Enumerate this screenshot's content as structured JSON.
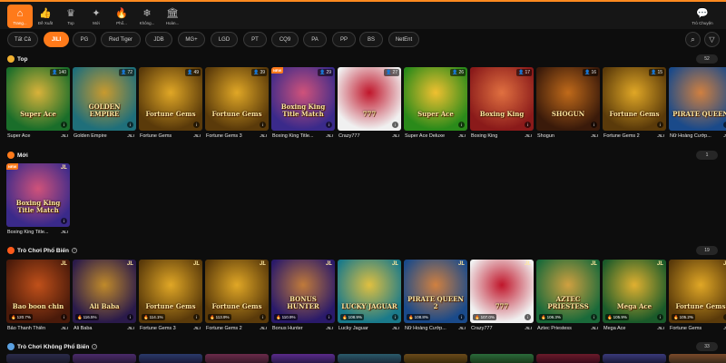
{
  "colors": {
    "accent": "#ff7a1a",
    "background": "#0d0d0d",
    "panel": "#161616"
  },
  "nav": {
    "items": [
      {
        "label": "Trang...",
        "icon": "home-icon",
        "glyph": "⌂",
        "active": true
      },
      {
        "label": "Đề Xuất",
        "icon": "thumbs-up-icon",
        "glyph": "👍",
        "active": false
      },
      {
        "label": "Top",
        "icon": "crown-icon",
        "glyph": "♛",
        "active": false
      },
      {
        "label": "Mới",
        "icon": "new-icon",
        "glyph": "✦",
        "active": false
      },
      {
        "label": "Phổ...",
        "icon": "fire-icon",
        "glyph": "🔥",
        "active": false
      },
      {
        "label": "Không...",
        "icon": "snowflake-icon",
        "glyph": "❄",
        "active": false
      },
      {
        "label": "Hoàn...",
        "icon": "gift-icon",
        "glyph": "🏛",
        "active": false
      }
    ],
    "right": {
      "label": "Trò Chuyện",
      "icon": "chat-icon",
      "glyph": "💬"
    }
  },
  "providers": [
    "Tất Cả",
    "JILI",
    "PG",
    "Red Tiger",
    "JDB",
    "MG+",
    "LGD",
    "PT",
    "CQ9",
    "PA",
    "PP",
    "BS",
    "NetEnt"
  ],
  "active_provider": "JILI",
  "sections": {
    "top": {
      "title": "Top",
      "count": "52",
      "games": [
        {
          "name": "Super Ace",
          "provider": "JILI",
          "players": "140",
          "logo": "Super Ace",
          "bg": "#1a6e2a",
          "bg2": "#d9b23a"
        },
        {
          "name": "Golden Empire",
          "provider": "JILI",
          "players": "72",
          "logo": "GOLDEN EMPIRE",
          "bg": "#1f6f7a",
          "bg2": "#c99a2e"
        },
        {
          "name": "Fortune Gems",
          "provider": "JILI",
          "players": "49",
          "logo": "Fortune Gems",
          "bg": "#5a3a0a",
          "bg2": "#e0a726"
        },
        {
          "name": "Fortune Gems 3",
          "provider": "JILI",
          "players": "39",
          "logo": "Fortune Gems",
          "bg": "#5a3a0a",
          "bg2": "#e0a726"
        },
        {
          "name": "Boxing King Title...",
          "provider": "JILI",
          "players": "29",
          "logo": "Boxing King Title Match",
          "bg": "#3a2a8a",
          "bg2": "#d0527a",
          "new": true
        },
        {
          "name": "Crazy777",
          "provider": "JILI",
          "players": "27",
          "logo": "777",
          "bg": "#f0f0f0",
          "bg2": "#c0162b"
        },
        {
          "name": "Super Ace Deluxe",
          "provider": "JILI",
          "players": "26",
          "logo": "Super Ace",
          "bg": "#2a8a1a",
          "bg2": "#f0c030"
        },
        {
          "name": "Boxing King",
          "provider": "JILI",
          "players": "17",
          "logo": "Boxing King",
          "bg": "#8a1a1a",
          "bg2": "#e07040"
        },
        {
          "name": "Shogun",
          "provider": "JILI",
          "players": "16",
          "logo": "SHOGUN",
          "bg": "#3a1a0a",
          "bg2": "#c06a1a"
        },
        {
          "name": "Fortune Gems 2",
          "provider": "JILI",
          "players": "15",
          "logo": "Fortune Gems",
          "bg": "#5a3a0a",
          "bg2": "#e0a726"
        },
        {
          "name": "Nữ Hoàng Cướp...",
          "provider": "JILI",
          "players": "",
          "logo": "PIRATE QUEEN",
          "bg": "#1a4a8a",
          "bg2": "#d08040"
        }
      ]
    },
    "new": {
      "title": "Mới",
      "count": "1",
      "games": [
        {
          "name": "Boxing King Title...",
          "provider": "JILI",
          "logo": "Boxing King Title Match",
          "bg": "#3a2a8a",
          "bg2": "#d0527a",
          "new": true,
          "jl": "JL"
        }
      ]
    },
    "popular": {
      "title": "Trò Chơi Phổ Biến",
      "count": "19",
      "games": [
        {
          "name": "Bảo Thanh Thiên",
          "provider": "JILI",
          "rtp": "120.7%",
          "logo": "Bao boon chin",
          "bg": "#4a1a0a",
          "bg2": "#c0501a",
          "jl": "JL"
        },
        {
          "name": "Ali Baba",
          "provider": "JILI",
          "rtp": "116.5%",
          "logo": "Ali Baba",
          "bg": "#2a1a4a",
          "bg2": "#c08a2a",
          "jl": "JL"
        },
        {
          "name": "Fortune Gems 3",
          "provider": "JILI",
          "rtp": "114.1%",
          "logo": "Fortune Gems",
          "bg": "#5a3a0a",
          "bg2": "#e0a726",
          "jl": "JL"
        },
        {
          "name": "Fortune Gems 2",
          "provider": "JILI",
          "rtp": "113.9%",
          "logo": "Fortune Gems",
          "bg": "#5a3a0a",
          "bg2": "#e0a726",
          "jl": "JL"
        },
        {
          "name": "Bonus Hunter",
          "provider": "JILI",
          "rtp": "110.9%",
          "logo": "BONUS HUNTER",
          "bg": "#2a1a6a",
          "bg2": "#c07a3a",
          "jl": "JL"
        },
        {
          "name": "Lucky Jaguar",
          "provider": "JILI",
          "rtp": "108.9%",
          "logo": "LUCKY JAGUAR",
          "bg": "#1a7a8a",
          "bg2": "#e0c040",
          "jl": "JL"
        },
        {
          "name": "Nữ Hoàng Cướp...",
          "provider": "JILI",
          "rtp": "108.8%",
          "logo": "PIRATE QUEEN 2",
          "bg": "#1a4a8a",
          "bg2": "#d08040",
          "jl": "JL"
        },
        {
          "name": "Crazy777",
          "provider": "JILI",
          "rtp": "107.0%",
          "logo": "777",
          "bg": "#f0f0f0",
          "bg2": "#c0162b",
          "jl": "JL"
        },
        {
          "name": "Aztec Priestess",
          "provider": "JILI",
          "rtp": "106.3%",
          "logo": "AZTEC PRIESTESS",
          "bg": "#1a6a3a",
          "bg2": "#d0a040",
          "jl": "JL"
        },
        {
          "name": "Mega Ace",
          "provider": "JILI",
          "rtp": "105.9%",
          "logo": "Mega Ace",
          "bg": "#1a5a2a",
          "bg2": "#e0b030",
          "jl": "JL"
        },
        {
          "name": "Fortune Gems",
          "provider": "JILI",
          "rtp": "105.2%",
          "logo": "Fortune Gems",
          "bg": "#5a3a0a",
          "bg2": "#e0a726",
          "jl": "JL"
        }
      ]
    },
    "unpopular": {
      "title": "Trò Chơi Không Phổ Biến",
      "count": "33"
    }
  }
}
